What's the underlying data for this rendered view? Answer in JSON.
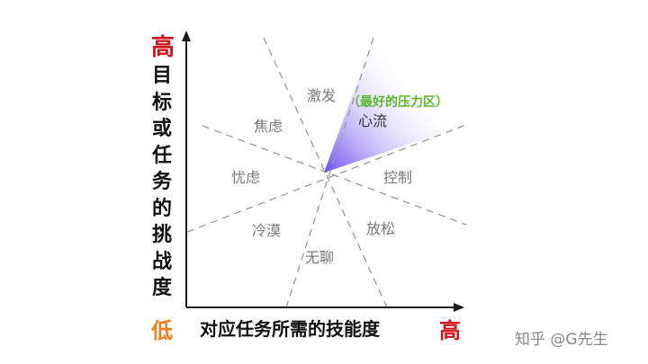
{
  "axis": {
    "y_high": "高",
    "y_label_chars": [
      "目",
      "标",
      "或",
      "任",
      "务",
      "的",
      "挑",
      "战",
      "度"
    ],
    "x_low": "低",
    "x_label": "对应任务所需的技能度",
    "x_high": "高"
  },
  "zones": {
    "arousal": "激发",
    "anxiety": "焦虑",
    "worry": "忧虑",
    "apathy": "冷漠",
    "boredom": "无聊",
    "relaxation": "放松",
    "control": "控制",
    "flow": "心流",
    "flow_note": "（最好的压力区）"
  },
  "watermark": "知乎 @G先生",
  "colors": {
    "high": "#d0141b",
    "low": "#f07e1b",
    "flow_gradient_start": "#6a4cf0",
    "flow_note": "#5cb82e",
    "divider": "#999999"
  }
}
